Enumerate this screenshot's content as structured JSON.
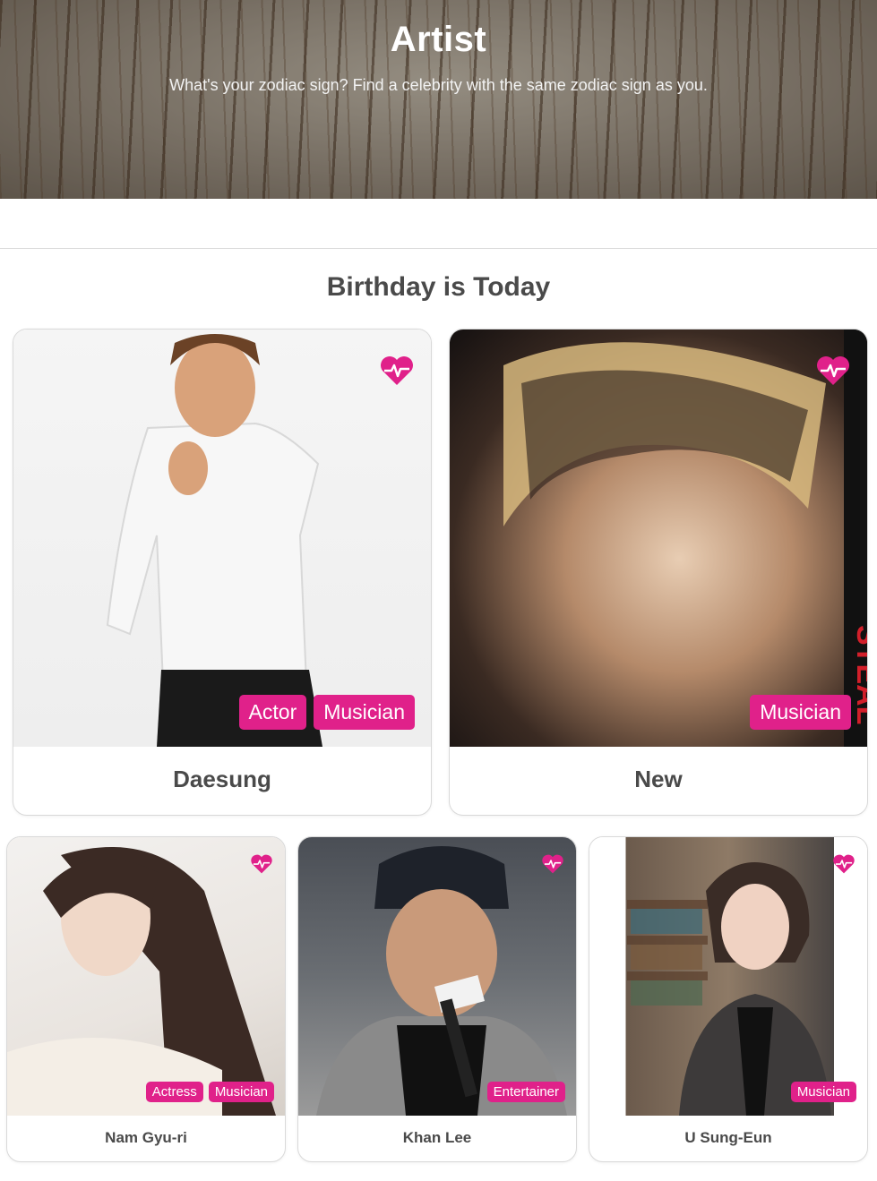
{
  "hero": {
    "title": "Artist",
    "subtitle": "What's your zodiac sign? Find a celebrity with the same zodiac sign as you."
  },
  "section": {
    "title": "Birthday is Today"
  },
  "colors": {
    "accent": "#e0218a",
    "text": "#4a4a4a",
    "border": "#d9d9d9"
  },
  "cards": [
    {
      "name": "Daesung",
      "tags": [
        "Actor",
        "Musician"
      ],
      "icon": "heart-pulse-icon"
    },
    {
      "name": "New",
      "tags": [
        "Musician"
      ],
      "icon": "heart-pulse-icon"
    },
    {
      "name": "Nam Gyu-ri",
      "tags": [
        "Actress",
        "Musician"
      ],
      "icon": "heart-pulse-icon"
    },
    {
      "name": "Khan Lee",
      "tags": [
        "Entertainer"
      ],
      "icon": "heart-pulse-icon"
    },
    {
      "name": "U Sung-Eun",
      "tags": [
        "Musician"
      ],
      "icon": "heart-pulse-icon"
    }
  ]
}
